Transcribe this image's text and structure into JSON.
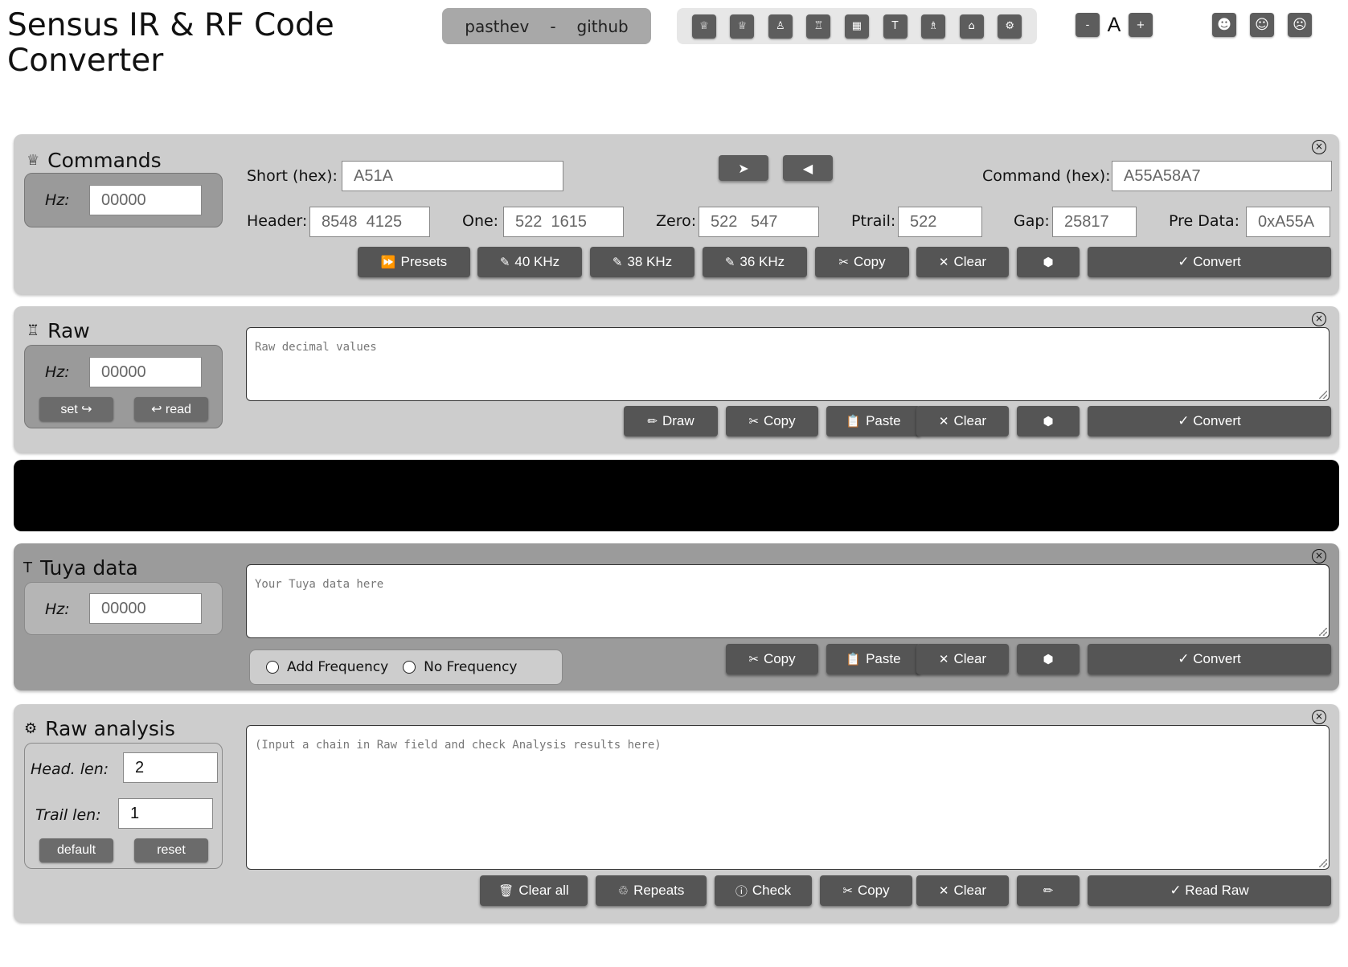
{
  "app": {
    "title": "Sensus IR & RF Code Converter"
  },
  "top_links": {
    "left": "pasthev",
    "separator": "-",
    "right": "github"
  },
  "toolbar_icons": [
    {
      "name": "commands-icon",
      "glyph": "♕"
    },
    {
      "name": "raw-icon",
      "glyph": "♕"
    },
    {
      "name": "pawn-icon",
      "glyph": "♙"
    },
    {
      "name": "rook-icon",
      "glyph": "♖"
    },
    {
      "name": "chart-icon",
      "glyph": "▦"
    },
    {
      "name": "tuya-icon",
      "glyph": "T"
    },
    {
      "name": "person-icon",
      "glyph": "♗"
    },
    {
      "name": "bag-icon",
      "glyph": "⌂"
    },
    {
      "name": "gear-icon",
      "glyph": "⚙"
    }
  ],
  "zoom": {
    "minus": "-",
    "label": "A",
    "plus": "+"
  },
  "faces": [
    "☻",
    "☺",
    "☹"
  ],
  "commands": {
    "title": "Commands",
    "icon": "♕",
    "hz_label": "Hz:",
    "hz_value": "00000",
    "short_label": "Short (hex):",
    "short_value": "A51A",
    "forward_arrow": "➤",
    "back_arrow": "◀",
    "command_label": "Command (hex):",
    "command_value": "A55A58A7",
    "header_label": "Header:",
    "header_value": "8548  4125",
    "one_label": "One:",
    "one_value": "522  1615",
    "zero_label": "Zero:",
    "zero_value": "522   547",
    "ptrail_label": "Ptrail:",
    "ptrail_value": "522",
    "gap_label": "Gap:",
    "gap_value": "25817",
    "predata_label": "Pre Data:",
    "predata_value": "0xA55A",
    "buttons": {
      "presets": "Presets",
      "khz40": "40 KHz",
      "khz38": "38 KHz",
      "khz36": "36 KHz",
      "copy": "Copy",
      "clear": "Clear",
      "convert": "✓ Convert"
    }
  },
  "raw": {
    "title": "Raw",
    "icon": "♖",
    "hz_label": "Hz:",
    "hz_value": "00000",
    "set_label": "set ↪",
    "read_label": "↩ read",
    "placeholder": "Raw decimal values",
    "buttons": {
      "draw": "Draw",
      "copy": "Copy",
      "paste": "Paste",
      "clear": "Clear",
      "convert": "✓ Convert"
    }
  },
  "tuya": {
    "title": "Tuya data",
    "icon": "T",
    "hz_label": "Hz:",
    "hz_value": "00000",
    "placeholder": "Your Tuya data here",
    "radio_add": "Add Frequency",
    "radio_none": "No Frequency",
    "buttons": {
      "copy": "Copy",
      "paste": "Paste",
      "clear": "Clear",
      "convert": "✓ Convert"
    }
  },
  "analysis": {
    "title": "Raw analysis",
    "icon": "⚙",
    "head_label": "Head. len:",
    "head_value": "2",
    "trail_label": "Trail len:",
    "trail_value": "1",
    "default_label": "default",
    "reset_label": "reset",
    "placeholder": "(Input a chain in Raw field and check Analysis results here)",
    "buttons": {
      "clear_all": "Clear all",
      "repeats": "Repeats",
      "check": "Check",
      "copy": "Copy",
      "clear": "Clear",
      "read_raw": "✓ Read Raw"
    }
  },
  "colors": {
    "panel_light": "#cdcdcd",
    "panel_dark": "#9b9b9b",
    "button": "#555555",
    "black_bar": "#000000"
  }
}
